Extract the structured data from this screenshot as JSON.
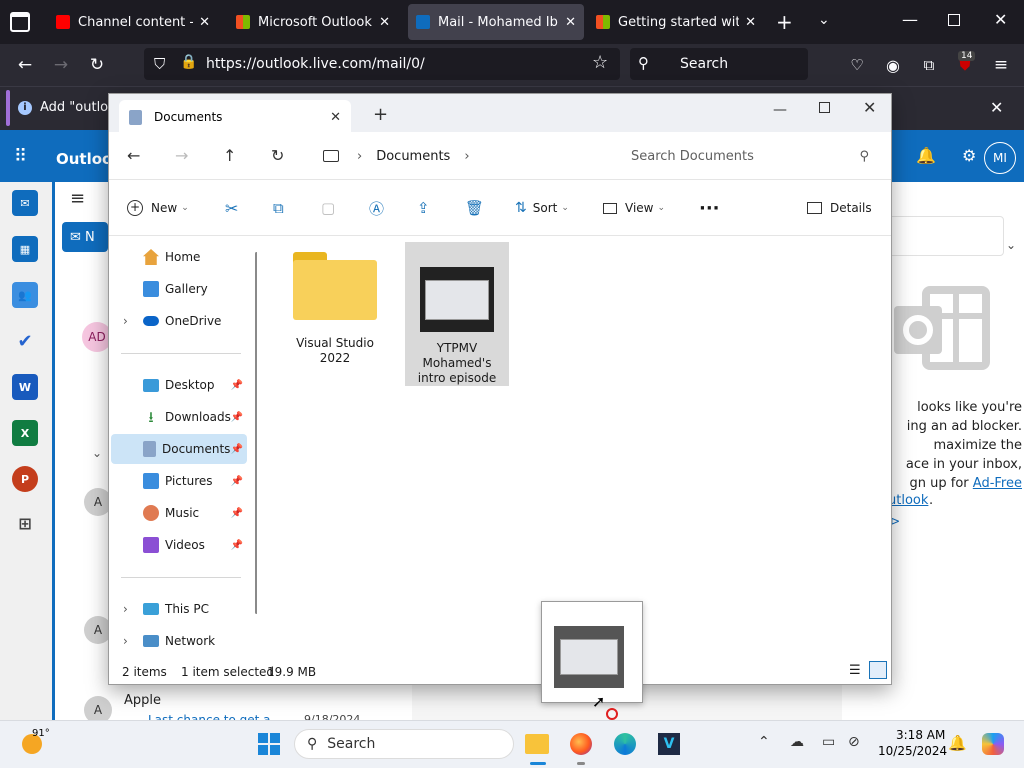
{
  "browser": {
    "tabs": [
      {
        "label": "Channel content - YouTube",
        "icon": "youtube-icon",
        "color": "#ff0000",
        "active": false
      },
      {
        "label": "Microsoft Outlook (formerly Hotmail)",
        "icon": "microsoft-icon",
        "color": "#f25022",
        "active": false
      },
      {
        "label": "Mail - Mohamed Ibrahim - Outlook",
        "icon": "outlook-icon",
        "color": "#0f6cbd",
        "active": true
      },
      {
        "label": "Getting started with the",
        "icon": "microsoft-icon",
        "color": "#f25022",
        "active": false
      }
    ],
    "url": "https://outlook.live.com/mail/0/",
    "search_placeholder": "Search",
    "extension_badge": "14",
    "notification_text": "Add \"outlook"
  },
  "outlook": {
    "app_name": "Outlook",
    "avatar_initials": "MI",
    "new_label": "N",
    "list_avatars": [
      "AD",
      "A",
      "A",
      "A"
    ],
    "last_sender": "Apple",
    "last_subject": "Last chance to get a",
    "last_date": "9/18/2024",
    "adblock_lines": [
      "looks like you're",
      "ing an ad blocker.",
      "maximize the",
      "ace in your inbox,",
      "gn up for "
    ],
    "adblock_link": "Ad-Free",
    "adblock_link2": "utlook",
    "adblock_tail": "."
  },
  "explorer": {
    "tab_title": "Documents",
    "breadcrumb": "Documents",
    "search_placeholder": "Search Documents",
    "commands": {
      "new": "New",
      "sort": "Sort",
      "view": "View",
      "details": "Details"
    },
    "nav": {
      "top": [
        {
          "label": "Home",
          "icon": "home-icon"
        },
        {
          "label": "Gallery",
          "icon": "gallery-icon"
        },
        {
          "label": "OneDrive",
          "icon": "onedrive-icon"
        }
      ],
      "quick": [
        {
          "label": "Desktop",
          "icon": "desktop-icon"
        },
        {
          "label": "Downloads",
          "icon": "downloads-icon"
        },
        {
          "label": "Documents",
          "icon": "documents-icon"
        },
        {
          "label": "Pictures",
          "icon": "pictures-icon"
        },
        {
          "label": "Music",
          "icon": "music-icon"
        },
        {
          "label": "Videos",
          "icon": "videos-icon"
        }
      ],
      "bottom": [
        {
          "label": "This PC",
          "icon": "this-pc-icon"
        },
        {
          "label": "Network",
          "icon": "network-icon"
        }
      ]
    },
    "items": [
      {
        "name": "Visual Studio 2022",
        "type": "folder"
      },
      {
        "name": "YTPMV Mohamed's intro episode",
        "type": "video",
        "selected": true
      }
    ],
    "status": {
      "count": "2 items",
      "selection": "1 item selected",
      "size": "19.9 MB"
    }
  },
  "taskbar": {
    "weather": "91°",
    "search_placeholder": "Search",
    "time": "3:18 AM",
    "date": "10/25/2024"
  }
}
